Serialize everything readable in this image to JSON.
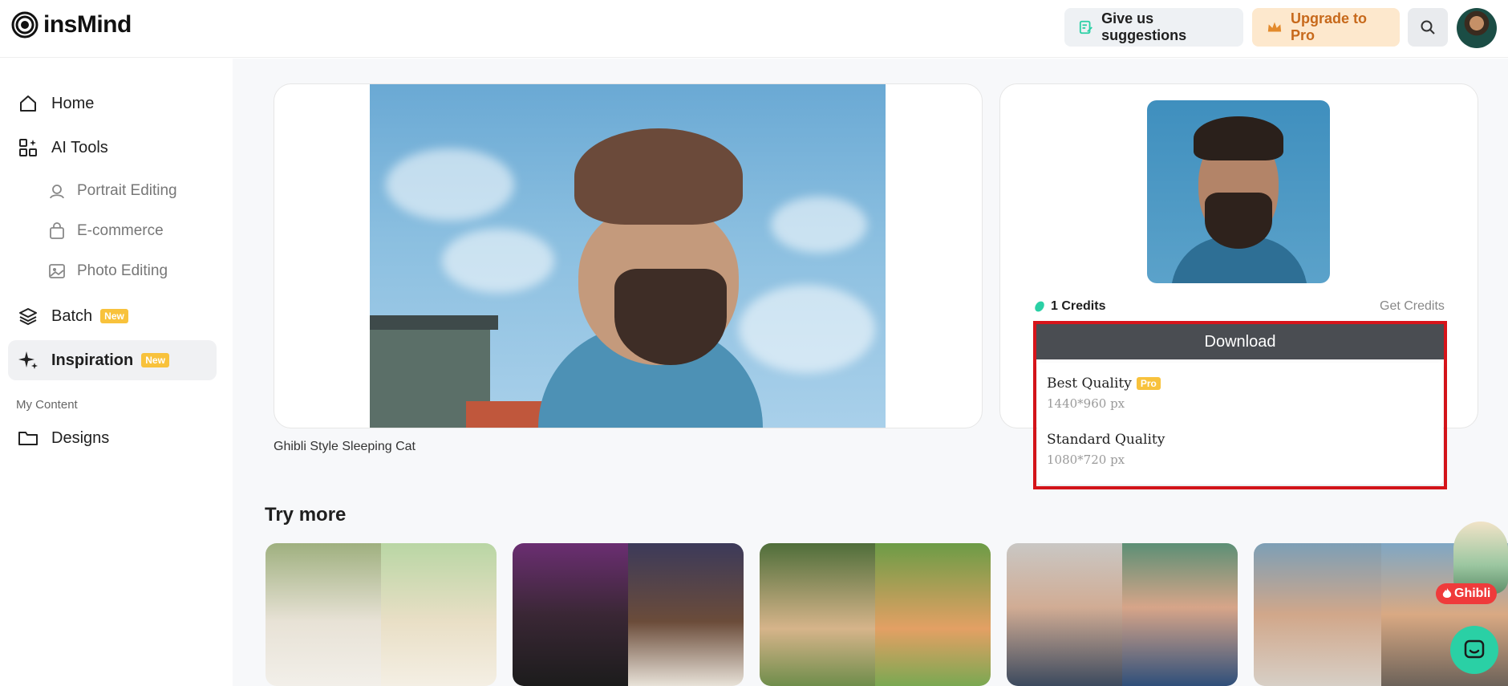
{
  "header": {
    "logo_text": "insMind",
    "suggest_label": "Give us suggestions",
    "upgrade_label": "Upgrade to Pro"
  },
  "sidebar": {
    "items": [
      {
        "label": "Home",
        "icon": "home-icon"
      },
      {
        "label": "AI Tools",
        "icon": "ai-tools-icon"
      },
      {
        "label": "Portrait Editing",
        "icon": "portrait-icon"
      },
      {
        "label": "E-commerce",
        "icon": "shopping-bag-icon"
      },
      {
        "label": "Photo Editing",
        "icon": "photo-icon"
      },
      {
        "label": "Batch",
        "icon": "layers-icon",
        "badge": "New"
      },
      {
        "label": "Inspiration",
        "icon": "sparkle-icon",
        "badge": "New"
      }
    ],
    "section_label": "My Content",
    "designs_label": "Designs"
  },
  "main": {
    "caption": "Ghibli Style Sleeping Cat",
    "credits_label": "1 Credits",
    "get_credits_label": "Get Credits",
    "download_label": "Download",
    "download_options": [
      {
        "title": "Best Quality",
        "badge": "Pro",
        "size": "1440*960 px"
      },
      {
        "title": "Standard Quality",
        "size": "1080*720 px"
      }
    ],
    "try_more_label": "Try more",
    "ghibli_label": "Ghibli"
  },
  "colors": {
    "accent_green": "#2ad0a5",
    "highlight_red": "#d7141a",
    "badge_yellow": "#f8c23c",
    "upgrade_orange": "#c7691b"
  }
}
